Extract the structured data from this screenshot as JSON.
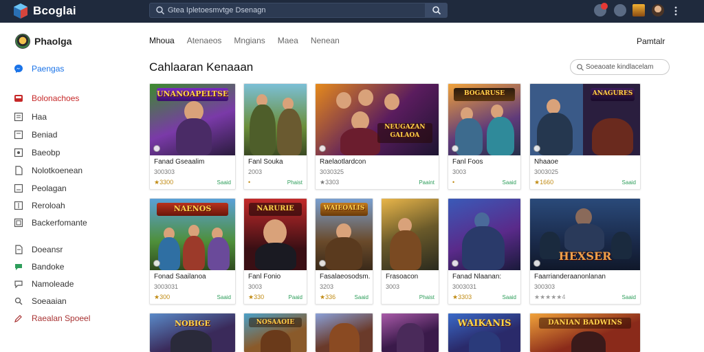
{
  "app": {
    "name": "Bcoglai"
  },
  "search": {
    "value": "Gtea Ipletoesmvtge Dsenagn"
  },
  "colors": {
    "topbar": "#1f2a3d",
    "accent": "#1a73e8",
    "status_green": "#2e9e5b",
    "star": "#e0a21b"
  },
  "profile": {
    "name": "Phaolga"
  },
  "sidebar": {
    "items": [
      {
        "label": "Paengas",
        "icon": "messenger-icon"
      },
      {
        "label": "Bolonachoes",
        "icon": "inbox-icon"
      },
      {
        "label": "Haa",
        "icon": "square-icon"
      },
      {
        "label": "Beniad",
        "icon": "square-icon"
      },
      {
        "label": "Baeobp",
        "icon": "square-icon"
      },
      {
        "label": "Nolotkoenean",
        "icon": "page-icon"
      },
      {
        "label": "Peolagan",
        "icon": "square-icon"
      },
      {
        "label": "Reroloah",
        "icon": "square-icon"
      },
      {
        "label": "Backerfomante",
        "icon": "square-icon"
      },
      {
        "label": "Doeansr",
        "icon": "page-icon"
      },
      {
        "label": "Bandoke",
        "icon": "chat-icon"
      },
      {
        "label": "Namoleade",
        "icon": "chat-icon"
      },
      {
        "label": "Soeaaian",
        "icon": "search-icon"
      },
      {
        "label": "Raealan Spoeel",
        "icon": "edit-icon"
      }
    ]
  },
  "tabs": [
    "Mhoua",
    "Atenaeos",
    "Mngians",
    "Maea",
    "Nenean"
  ],
  "top_right_link": "Pamtalr",
  "section_title": "Cahlaaran Kenaaan",
  "filter": {
    "label": "Soeaoate kindlacelam"
  },
  "cards": [
    {
      "title": "Fanad Gseaalim",
      "sub": "300303",
      "rating": "★3300",
      "status": "Saaid"
    },
    {
      "title": "Fanl Souka",
      "sub": "2003",
      "rating": "•",
      "status": "Phaist"
    },
    {
      "title": "Raelaotlardcon",
      "sub": "3030325",
      "rating": "★3303",
      "status": "Paaint"
    },
    {
      "title": "Fanl Foos",
      "sub": "3003",
      "rating": "•",
      "status": "Saaid"
    },
    {
      "title": "Nhaaoe",
      "sub": "3003025",
      "rating": "★1660",
      "status": "Saaid"
    },
    {
      "title": "Fonad Saailanoa",
      "sub": "3003031",
      "rating": "★300",
      "status": "Saaid"
    },
    {
      "title": "Fanl Fonio",
      "sub": "3003",
      "rating": "★330",
      "status": "Paaid"
    },
    {
      "title": "Fasalaeosodsm.",
      "sub": "3203",
      "rating": "★336",
      "status": "Saaid"
    },
    {
      "title": "Frasoacon",
      "sub": "3003",
      "rating": "",
      "status": "Phaist"
    },
    {
      "title": "Fanad Nlaanan:",
      "sub": "3003031",
      "rating": "★3303",
      "status": "Saaid"
    },
    {
      "title": "Faarrianderaanonlanan",
      "sub": "300303",
      "rating": "★★★★★4",
      "status": "Saaid"
    }
  ],
  "card_banners": [
    "UNANOAPELTSEIRAD",
    "",
    "NEUGAZAN GALAOA",
    "BOGARUSE",
    "ANAGURES",
    "NAENOS",
    "NARURIE",
    "WAIEOALIS",
    "",
    "",
    "HEXSER",
    "NOBIGE",
    "NOSAAOIE",
    "",
    "",
    "WAIKANIS",
    "DANIAN BADWINS"
  ]
}
